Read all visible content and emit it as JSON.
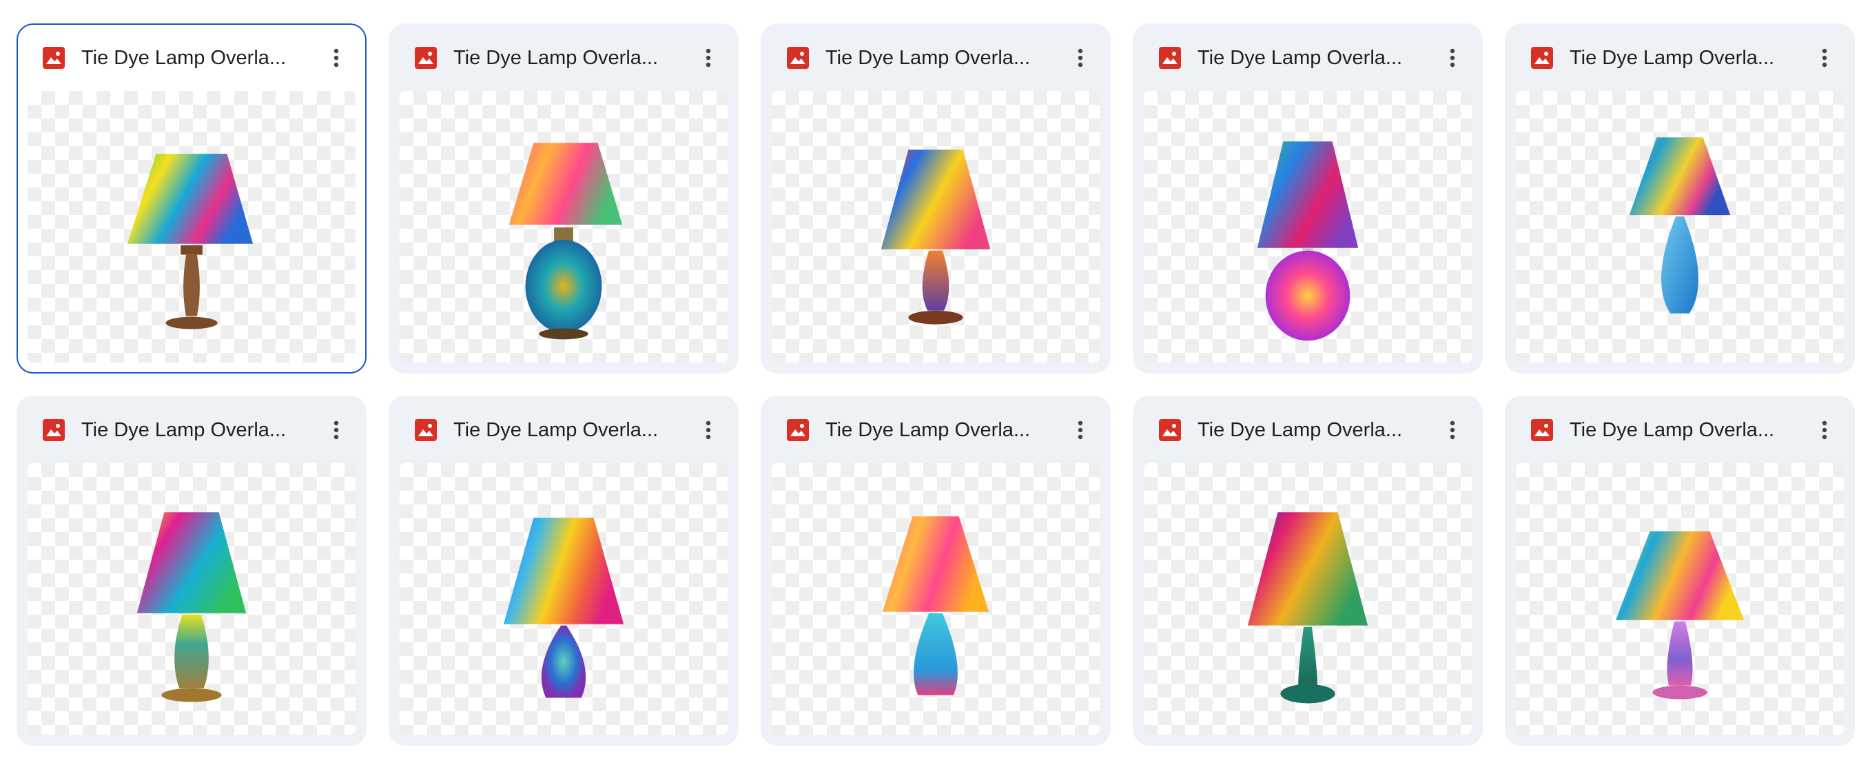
{
  "colors": {
    "selected_border": "#1a5dc8",
    "card_bg": "#eef1f6",
    "image_icon": "#d93025"
  },
  "files": [
    {
      "name": "Tie Dye Lamp Overla...",
      "icon": "image-icon",
      "selected": true
    },
    {
      "name": "Tie Dye Lamp Overla...",
      "icon": "image-icon",
      "selected": false
    },
    {
      "name": "Tie Dye Lamp Overla...",
      "icon": "image-icon",
      "selected": false
    },
    {
      "name": "Tie Dye Lamp Overla...",
      "icon": "image-icon",
      "selected": false
    },
    {
      "name": "Tie Dye Lamp Overla...",
      "icon": "image-icon",
      "selected": false
    },
    {
      "name": "Tie Dye Lamp Overla...",
      "icon": "image-icon",
      "selected": false
    },
    {
      "name": "Tie Dye Lamp Overla...",
      "icon": "image-icon",
      "selected": false
    },
    {
      "name": "Tie Dye Lamp Overla...",
      "icon": "image-icon",
      "selected": false
    },
    {
      "name": "Tie Dye Lamp Overla...",
      "icon": "image-icon",
      "selected": false
    },
    {
      "name": "Tie Dye Lamp Overla...",
      "icon": "image-icon",
      "selected": false
    }
  ]
}
